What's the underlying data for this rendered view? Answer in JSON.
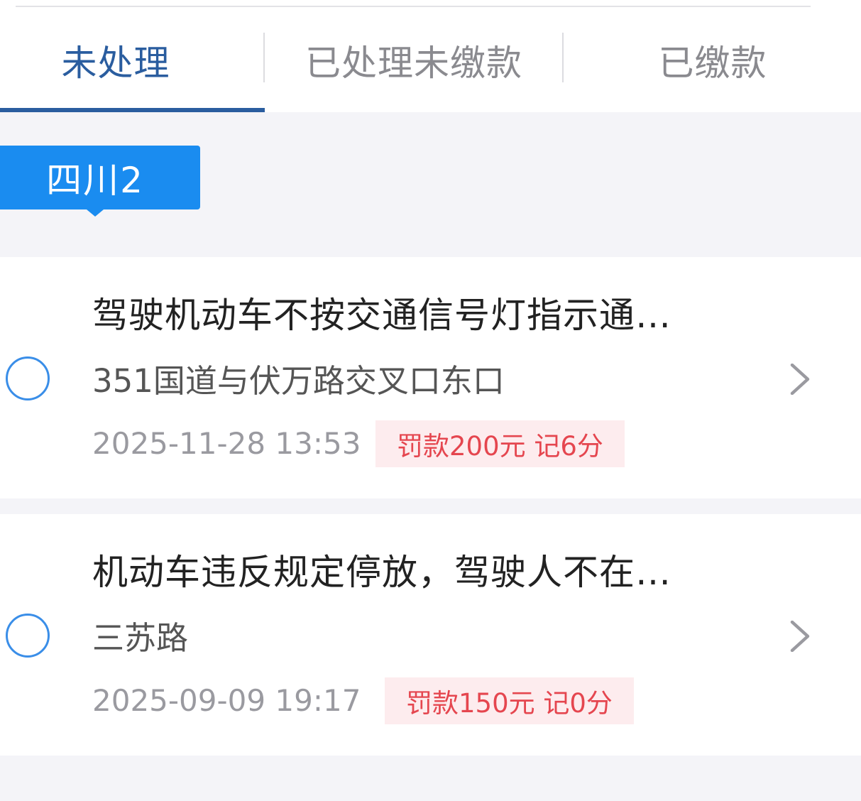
{
  "tabs": [
    {
      "label": "未处理",
      "active": true
    },
    {
      "label": "已处理未缴款",
      "active": false
    },
    {
      "label": "已缴款",
      "active": false
    }
  ],
  "plate": {
    "label": "四川2"
  },
  "violations": [
    {
      "title": "驾驶机动车不按交通信号灯指示通…",
      "location": "351国道与伏万路交叉口东口",
      "time": "2025-11-28 13:53",
      "fine": "罚款200元 记6分"
    },
    {
      "title": "机动车违反规定停放，驾驶人不在…",
      "location": "三苏路",
      "time": "2025-09-09 19:17",
      "fine": "罚款150元 记0分"
    }
  ],
  "colors": {
    "accent": "#2a5d9f",
    "badge": "#1a8cf0",
    "fine_text": "#e5464f",
    "fine_bg": "#fdecee"
  },
  "icons": {
    "select": "radio-circle-icon",
    "navigate": "chevron-right-icon"
  }
}
